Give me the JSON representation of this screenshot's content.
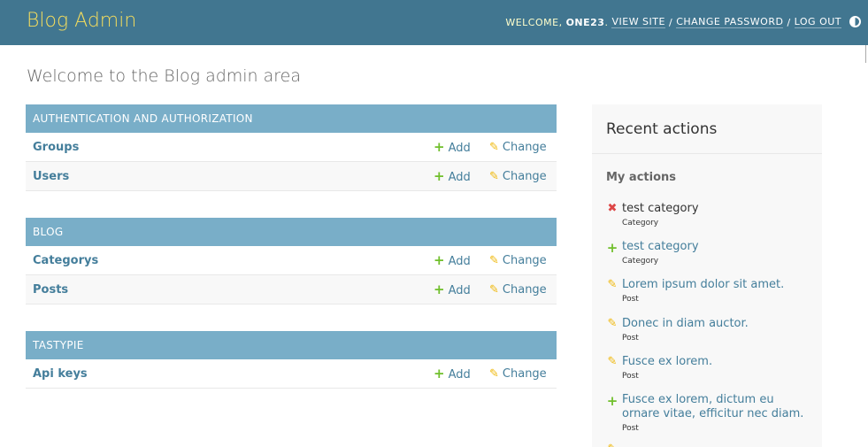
{
  "header": {
    "brand": "Blog Admin",
    "welcome": "WELCOME,",
    "username": "ONE23",
    "view_site": "VIEW SITE",
    "change_password": "CHANGE PASSWORD",
    "log_out": "LOG OUT",
    "separator": "/"
  },
  "page_title": "Welcome to the Blog admin area",
  "modules": [
    {
      "caption": "AUTHENTICATION AND AUTHORIZATION",
      "rows": [
        {
          "name": "Groups",
          "add": "Add",
          "change": "Change"
        },
        {
          "name": "Users",
          "add": "Add",
          "change": "Change"
        }
      ]
    },
    {
      "caption": "BLOG",
      "rows": [
        {
          "name": "Categorys",
          "add": "Add",
          "change": "Change"
        },
        {
          "name": "Posts",
          "add": "Add",
          "change": "Change"
        }
      ]
    },
    {
      "caption": "TASTYPIE",
      "rows": [
        {
          "name": "Api keys",
          "add": "Add",
          "change": "Change"
        }
      ]
    }
  ],
  "recent_actions": {
    "title": "Recent actions",
    "subtitle": "My actions",
    "items": [
      {
        "icon": "delete-icon",
        "text": "test category",
        "type": "Category"
      },
      {
        "icon": "add-icon",
        "text": "test category",
        "type": "Category"
      },
      {
        "icon": "change-icon",
        "text": "Lorem ipsum dolor sit amet.",
        "type": "Post"
      },
      {
        "icon": "change-icon",
        "text": "Donec in diam auctor.",
        "type": "Post"
      },
      {
        "icon": "change-icon",
        "text": "Fusce ex lorem.",
        "type": "Post"
      },
      {
        "icon": "add-icon",
        "text": "Fusce ex lorem, dictum eu ornare vitae, efficitur nec diam.",
        "type": "Post"
      }
    ]
  },
  "colors": {
    "header_bg": "#417690",
    "brand": "#f5dd5d",
    "caption_bg": "#79aec8",
    "link": "#447e9b",
    "add_icon": "#70bf2b",
    "change_icon": "#efb80b",
    "delete_icon": "#dd4646"
  }
}
